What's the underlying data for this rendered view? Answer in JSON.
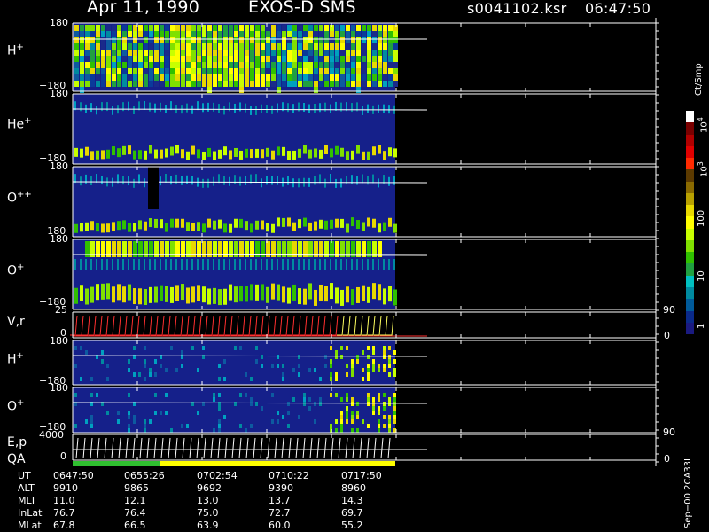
{
  "header": {
    "date": "Apr 11, 1990",
    "instrument": "EXOS-D SMS",
    "file": "s0041102.ksr",
    "time": "06:47:50"
  },
  "panels": [
    {
      "label": "H",
      "sup": "+",
      "top": "180",
      "bottom": "−180"
    },
    {
      "label": "He",
      "sup": "+",
      "top": "180",
      "bottom": "−180"
    },
    {
      "label": "O",
      "sup": "++",
      "top": "180",
      "bottom": "−180"
    },
    {
      "label": "O",
      "sup": "+",
      "top": "180",
      "bottom": "−180"
    },
    {
      "label": "V,r",
      "sup": "",
      "top": "25",
      "bottom": "0",
      "right_top": "90",
      "right_bottom": "0"
    },
    {
      "label": "H",
      "sup": "+",
      "top": "180",
      "bottom": "−180"
    },
    {
      "label": "O",
      "sup": "+",
      "top": "180",
      "bottom": "−180"
    },
    {
      "label": "E,p",
      "sup": "",
      "top": "4000",
      "bottom": "0",
      "right_top": "90",
      "right_bottom": "0"
    }
  ],
  "qa_label": "QA",
  "footer": {
    "rows": [
      {
        "name": "UT",
        "values": [
          "0647:50",
          "0655:26",
          "0702:54",
          "0710:22",
          "0717:50"
        ]
      },
      {
        "name": "ALT",
        "values": [
          "9910",
          "9865",
          "9692",
          "9390",
          "8960"
        ]
      },
      {
        "name": "MLT",
        "values": [
          "11.0",
          "12.1",
          "13.0",
          "13.7",
          "14.3"
        ]
      },
      {
        "name": "InLat",
        "values": [
          "76.7",
          "76.4",
          "75.0",
          "72.7",
          "69.7"
        ]
      },
      {
        "name": "MLat",
        "values": [
          "67.8",
          "66.5",
          "63.9",
          "60.0",
          "55.2"
        ]
      }
    ]
  },
  "colorbar": {
    "unit": "Ct/Smp",
    "ticks": [
      "10",
      "4",
      "10",
      "3",
      "100",
      "10",
      "1"
    ],
    "colors": [
      "#ffffff",
      "#7a0000",
      "#b00000",
      "#e00000",
      "#ff2a00",
      "#5c3a00",
      "#8a6a00",
      "#b8a000",
      "#e8d800",
      "#ffff00",
      "#c8ff00",
      "#80e000",
      "#30c000",
      "#20a040",
      "#00c0c0",
      "#008aa0",
      "#005a9a",
      "#0a2a8a",
      "#1a1a80"
    ]
  },
  "version_text": "Sep−00 2CA33L",
  "chart_data": {
    "type": "heatmap",
    "title": "Apr 11, 1990   EXOS-D SMS",
    "x_ticks": [
      "0647:50",
      "0655:26",
      "0702:54",
      "0710:22",
      "0717:50"
    ],
    "x_range": [
      "06:47:50",
      "07:17:50"
    ],
    "series": [
      {
        "name": "H+",
        "y_range": [
          -180,
          180
        ]
      },
      {
        "name": "He+",
        "y_range": [
          -180,
          180
        ]
      },
      {
        "name": "O++",
        "y_range": [
          -180,
          180
        ]
      },
      {
        "name": "O+",
        "y_range": [
          -180,
          180
        ]
      },
      {
        "name": "V,r",
        "y_range": [
          0,
          25
        ],
        "y2_range": [
          0,
          90
        ]
      },
      {
        "name": "H+",
        "y_range": [
          -180,
          180
        ]
      },
      {
        "name": "O+",
        "y_range": [
          -180,
          180
        ]
      },
      {
        "name": "E,p",
        "y_range": [
          0,
          4000
        ],
        "y2_range": [
          0,
          90
        ]
      }
    ],
    "colorbar_range": [
      1,
      10000
    ],
    "colorbar_unit": "Ct/Smp",
    "colorbar_scale": "log"
  }
}
